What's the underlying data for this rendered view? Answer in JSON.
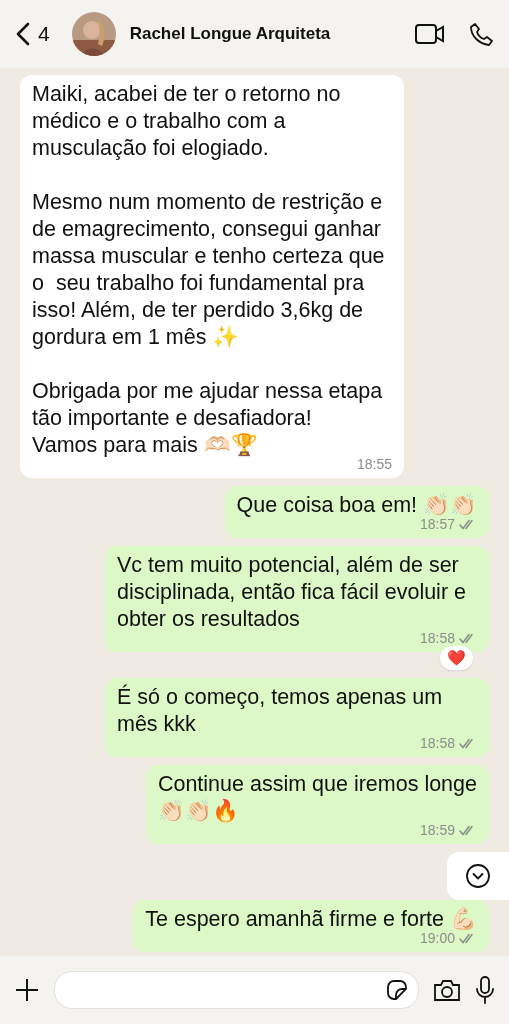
{
  "header": {
    "back_count": "4",
    "contact_name": "Rachel Longue Arquiteta"
  },
  "messages": [
    {
      "kind": "in",
      "text": "Maiki, acabei de ter o retorno no médico e o trabalho com a musculação foi elogiado.\n\nMesmo num momento de restrição e de emagrecimento, consegui ganhar massa muscular e tenho certeza que o  seu trabalho foi fundamental pra isso! Além, de ter perdido 3,6kg de gordura em 1 mês ✨\n\nObrigada por me ajudar nessa etapa tão importante e desafiadora!\nVamos para mais 🫶🏻🏆",
      "time": "18:55"
    },
    {
      "kind": "out",
      "text": "Que coisa boa em! 👏🏻👏🏻",
      "time": "18:57",
      "read": false
    },
    {
      "kind": "out",
      "text": "Vc tem muito potencial, além de ser disciplinada, então fica fácil evoluir e obter os resultados",
      "time": "18:58",
      "read": false,
      "reaction": "❤️"
    },
    {
      "kind": "out",
      "text": "É só o começo, temos apenas um mês kkk",
      "time": "18:58",
      "read": false
    },
    {
      "kind": "out",
      "text": "Continue assim que iremos longe\n👏🏻👏🏻🔥",
      "time": "18:59",
      "read": false
    },
    {
      "kind": "out",
      "text": "Te espero amanhã firme e forte 💪🏻",
      "time": "19:00",
      "read": false
    }
  ]
}
